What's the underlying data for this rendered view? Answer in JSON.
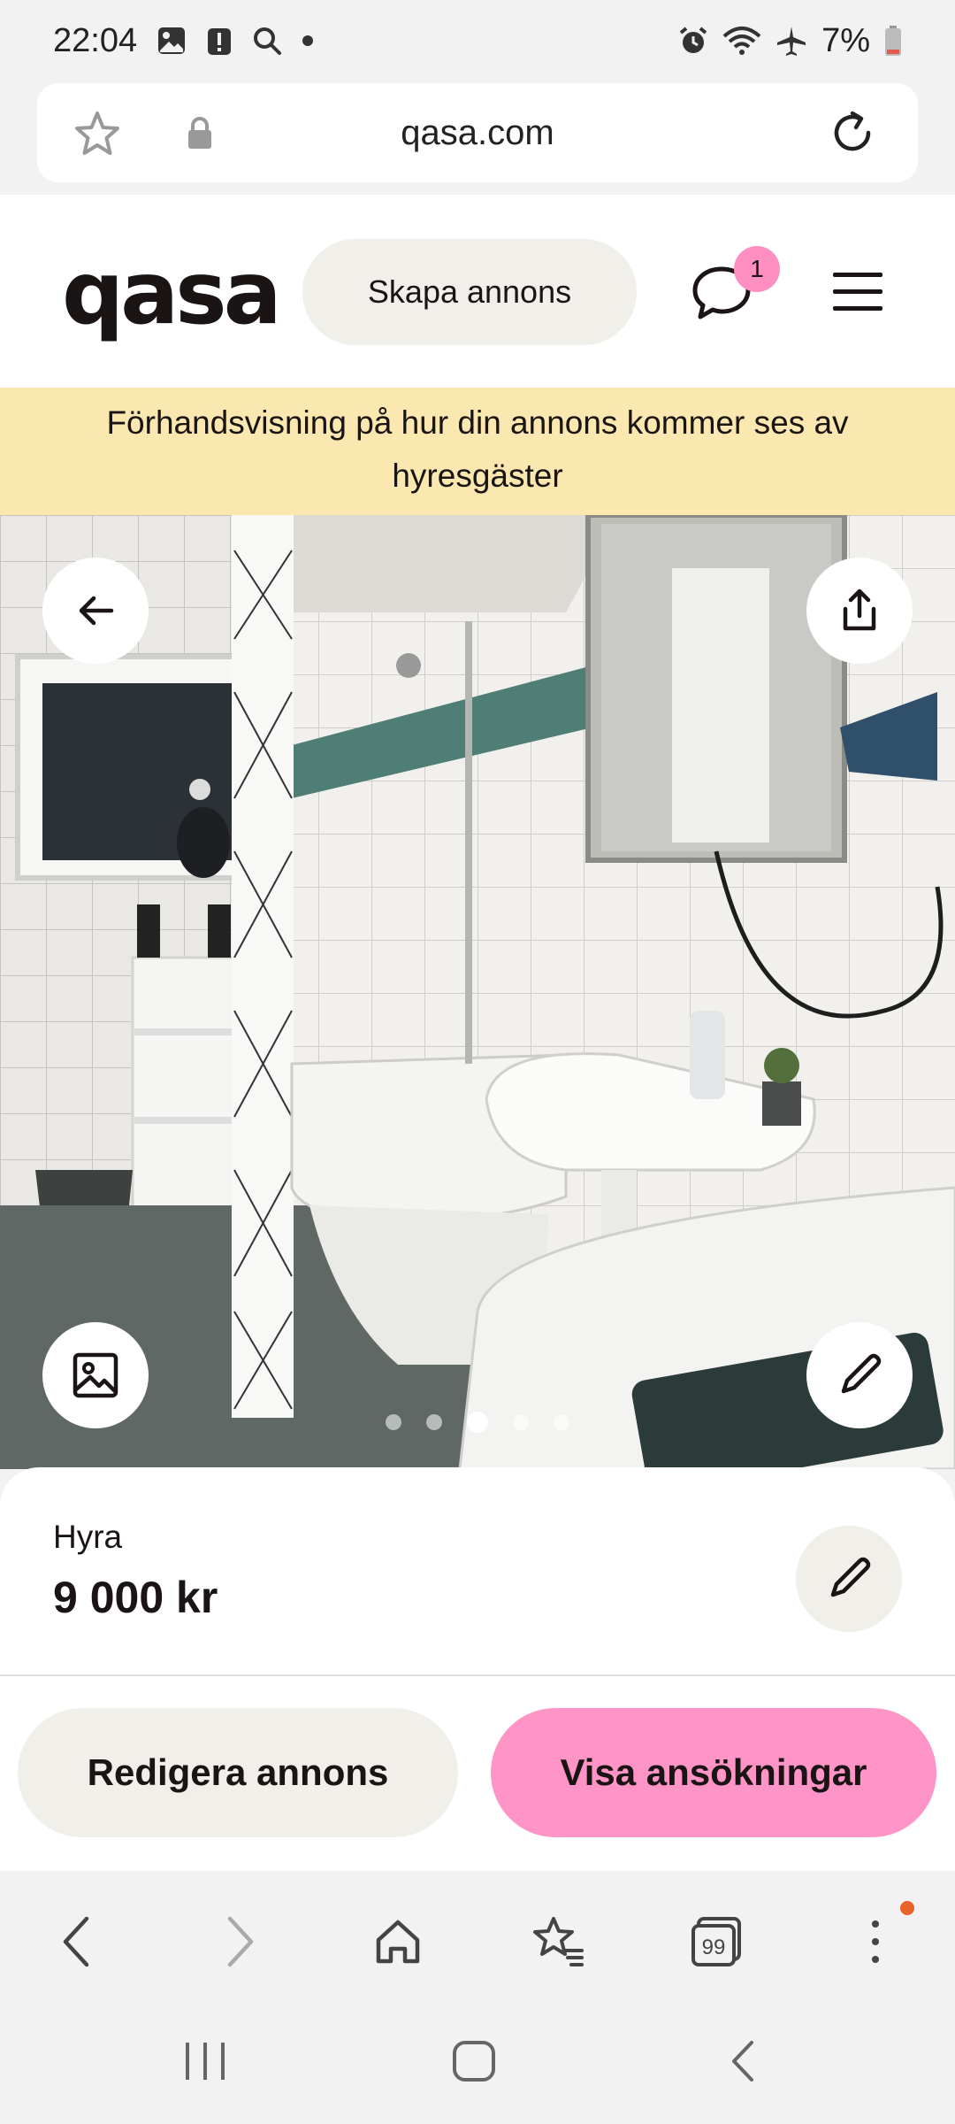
{
  "status_bar": {
    "time": "22:04",
    "battery": "7%"
  },
  "browser": {
    "url": "qasa.com"
  },
  "header": {
    "logo": "qasa",
    "create_label": "Skapa annons",
    "message_badge": "1"
  },
  "banner": {
    "text": "Förhandsvisning på hur din annons kommer ses av hyresgäster"
  },
  "gallery": {
    "image_count": 5,
    "active_index": 2
  },
  "price": {
    "label": "Hyra",
    "value": "9 000 kr"
  },
  "actions": {
    "edit_label": "Redigera annons",
    "applications_label": "Visa ansökningar"
  },
  "browser_nav": {
    "tabs_count": "99"
  },
  "colors": {
    "brand_pink": "#ff94c6",
    "banner_yellow": "#fbe8b0",
    "neutral_button": "#f0efe9"
  }
}
